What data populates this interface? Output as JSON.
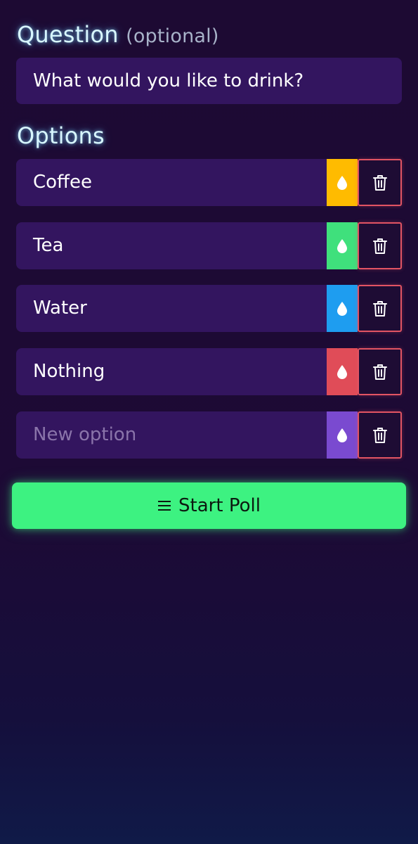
{
  "question": {
    "title": "Question",
    "subtitle": "(optional)",
    "value": "What would you like to drink?"
  },
  "options": {
    "title": "Options",
    "items": [
      {
        "label": "Coffee",
        "color": "#ffbb00",
        "color_icon": "droplet-icon",
        "delete_icon": "trash-icon"
      },
      {
        "label": "Tea",
        "color": "#3fe07c",
        "color_icon": "droplet-icon",
        "delete_icon": "trash-icon"
      },
      {
        "label": "Water",
        "color": "#1e9df0",
        "color_icon": "droplet-icon",
        "delete_icon": "trash-icon"
      },
      {
        "label": "Nothing",
        "color": "#e04c58",
        "color_icon": "droplet-icon",
        "delete_icon": "trash-icon"
      }
    ],
    "new_option": {
      "placeholder": "New option",
      "color": "#7a4ad0",
      "color_icon": "droplet-icon",
      "delete_icon": "trash-icon"
    }
  },
  "start_button": {
    "label": "Start Poll",
    "icon": "menu-icon",
    "color": "#3df281"
  },
  "colors": {
    "background": "#1d0a33",
    "field": "#33155f",
    "delete_border": "#e25463"
  }
}
